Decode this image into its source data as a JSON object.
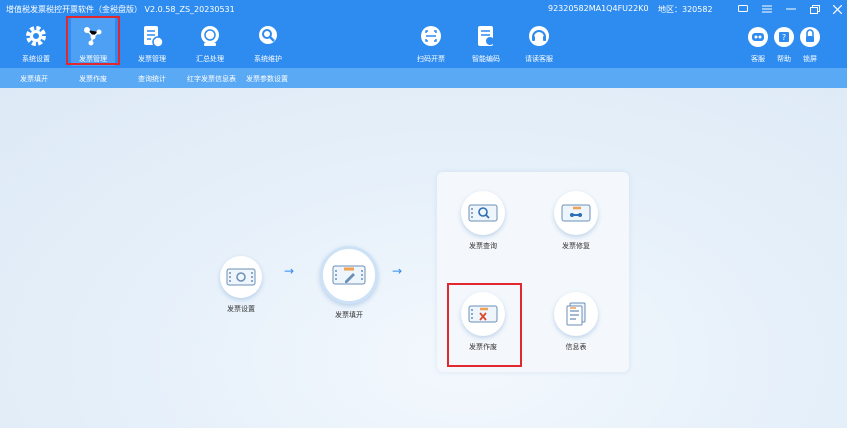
{
  "window": {
    "title": "增值税发票税控开票软件（金税盘版） V2.0.58_ZS_20230531",
    "tax_id": "92320582MA1Q4FU22K0",
    "region": "地区：320582"
  },
  "toolbar": {
    "items": [
      {
        "label": "系统设置",
        "icon": "gear-icon"
      },
      {
        "label": "发票管理",
        "icon": "network-icon"
      },
      {
        "label": "发票管理",
        "icon": "invoice-manage-icon"
      },
      {
        "label": "汇总处理",
        "icon": "summary-icon"
      },
      {
        "label": "系统维护",
        "icon": "maintenance-icon"
      },
      {
        "label": "扫码开票",
        "icon": "scan-icon"
      },
      {
        "label": "智能编码",
        "icon": "smart-code-icon"
      },
      {
        "label": "请读客服",
        "icon": "headset-icon"
      }
    ],
    "right_items": [
      {
        "label": "客服",
        "icon": "robot-icon"
      },
      {
        "label": "帮助",
        "icon": "help-icon"
      },
      {
        "label": "锁屏",
        "icon": "lock-icon"
      }
    ]
  },
  "subnav": {
    "items": [
      "发票填开",
      "发票作废",
      "查询统计",
      "红字发票信息表",
      "发票参数设置"
    ]
  },
  "flow": {
    "nodes": [
      {
        "label": "发票设置",
        "icon": "invoice-settings-icon"
      },
      {
        "label": "发票填开",
        "icon": "invoice-fill-icon"
      }
    ],
    "arrows": [
      "→",
      "→"
    ],
    "panel_nodes": [
      {
        "label": "发票查询",
        "icon": "invoice-query-icon"
      },
      {
        "label": "发票修复",
        "icon": "invoice-repair-icon"
      },
      {
        "label": "发票作废",
        "icon": "invoice-void-icon"
      },
      {
        "label": "信息表",
        "icon": "info-sheet-icon"
      }
    ]
  },
  "colors": {
    "header_blue": "#2e8cf0",
    "subnav_blue": "#5aa9f5",
    "highlight_red": "#e0282e"
  }
}
